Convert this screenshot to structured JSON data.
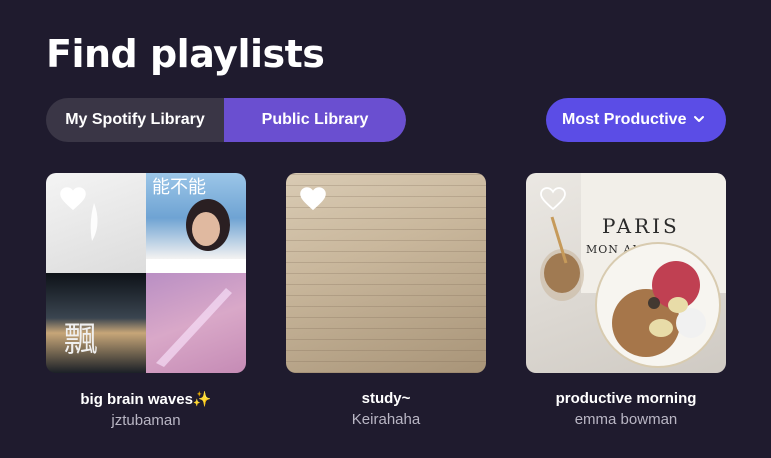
{
  "page": {
    "title": "Find playlists"
  },
  "library_toggle": {
    "options": [
      {
        "label": "My Spotify Library",
        "selected": false
      },
      {
        "label": "Public Library",
        "selected": true
      }
    ]
  },
  "sort": {
    "label": "Most Productive",
    "icon": "chevron-down-icon"
  },
  "colors": {
    "background": "#1f1b2e",
    "accent": "#5b4de6",
    "toggle_selected": "#6a4fd0"
  },
  "playlists": [
    {
      "name": "big brain waves✨",
      "owner": "jztubaman",
      "liked": false,
      "icon": "heart-outline-icon"
    },
    {
      "name": "study~",
      "owner": "Keirahaha",
      "liked": true,
      "icon": "heart-filled-icon"
    },
    {
      "name": "productive morning",
      "owner": "emma bowman",
      "liked": false,
      "icon": "heart-outline-icon"
    }
  ],
  "cover_art": {
    "collage_text_1": "能不能",
    "collage_text_2": "飄",
    "morning_title": "PARIS",
    "morning_subtitle": "MON AMOUR"
  }
}
